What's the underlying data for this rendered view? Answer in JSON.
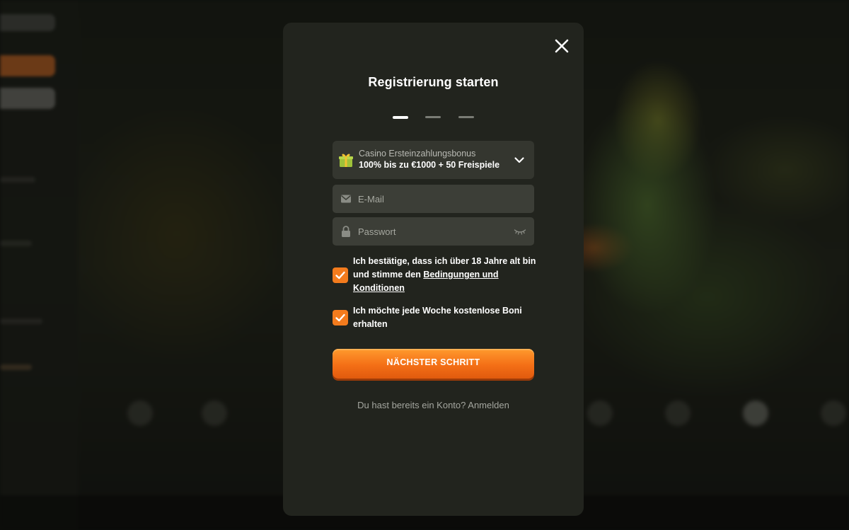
{
  "modal": {
    "title": "Registrierung starten",
    "steps_total": 3,
    "current_step": 1
  },
  "bonus": {
    "label": "Casino Ersteinzahlungsbonus",
    "offer": "100% bis zu €1000 + 50 Freispiele"
  },
  "form": {
    "email_placeholder": "E-Mail",
    "password_placeholder": "Passwort"
  },
  "consents": {
    "terms_prefix": "Ich bestätige, dass ich über 18 Jahre alt bin und stimme den ",
    "terms_link": "Bedingungen und Konditionen",
    "terms_checked": true,
    "weekly_bonus": "Ich möchte jede Woche kostenlose Boni erhalten",
    "weekly_bonus_checked": true
  },
  "actions": {
    "next_label": "NÄCHSTER SCHRITT",
    "login_prompt": "Du hast bereits ein Konto? Anmelden"
  },
  "colors": {
    "modal_bg": "#22241e",
    "accent": "#f37b1d",
    "field_bg": "#3c3e37"
  },
  "icons": {
    "close": "close-icon",
    "gift": "gift-icon",
    "chevron": "chevron-down-icon",
    "email": "envelope-icon",
    "password": "lock-icon",
    "toggle_password": "eye-closed-icon",
    "check": "checkmark-icon"
  }
}
